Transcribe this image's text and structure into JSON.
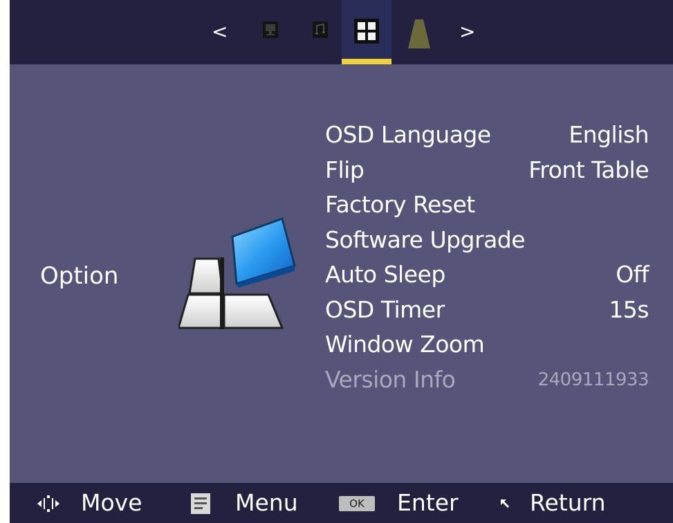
{
  "nav": {
    "prev_label": "<",
    "next_label": ">",
    "tabs": [
      {
        "icon": "monitor-icon",
        "active": false
      },
      {
        "icon": "audio-icon",
        "active": false
      },
      {
        "icon": "grid-icon",
        "active": true
      },
      {
        "icon": "cone-icon",
        "active": false
      }
    ]
  },
  "section": {
    "title": "Option",
    "icon": "option-cubes-icon"
  },
  "menu": {
    "items": [
      {
        "label": "OSD Language",
        "value": "English"
      },
      {
        "label": "Flip",
        "value": "Front Table"
      },
      {
        "label": "Factory Reset",
        "value": ""
      },
      {
        "label": "Software Upgrade",
        "value": ""
      },
      {
        "label": "Auto Sleep",
        "value": "Off"
      },
      {
        "label": "OSD Timer",
        "value": "15s"
      },
      {
        "label": "Window Zoom",
        "value": ""
      },
      {
        "label": "Version Info",
        "value": "2409111933"
      }
    ]
  },
  "footer": {
    "move_label": "Move",
    "menu_label": "Menu",
    "ok_badge": "OK",
    "enter_label": "Enter",
    "return_label": "Return"
  },
  "colors": {
    "background": "#565478",
    "bar": "#23213f",
    "active_underline": "#f2d23a",
    "disabled_text": "#a9a8bf"
  }
}
